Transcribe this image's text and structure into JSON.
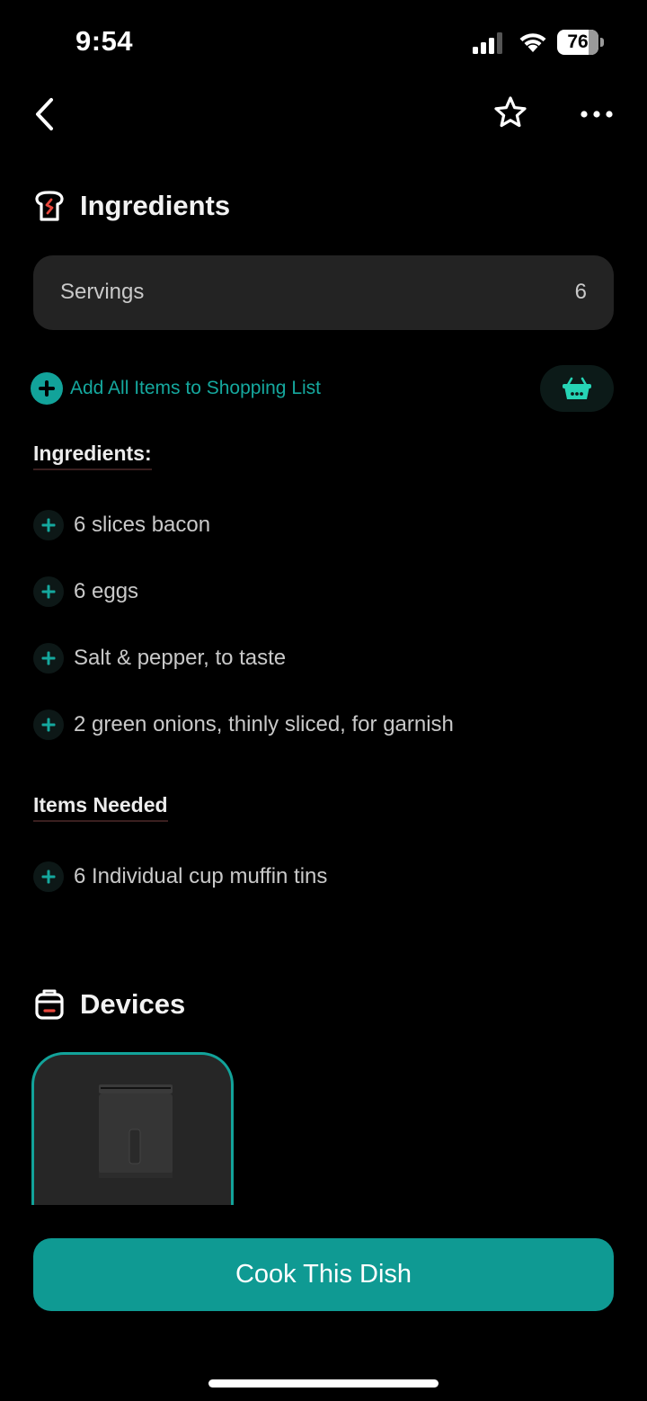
{
  "status_bar": {
    "time": "9:54",
    "battery": 76
  },
  "ingredients_section": {
    "title": "Ingredients",
    "servings": {
      "label": "Servings",
      "value": "6"
    },
    "add_all_label": "Add All Items to Shopping List",
    "subheading": "Ingredients:",
    "items": [
      "6 slices bacon",
      "6 eggs",
      "Salt & pepper, to taste",
      "2 green onions, thinly sliced, for garnish"
    ]
  },
  "items_needed": {
    "subheading": "Items Needed",
    "items": [
      "6 Individual cup muffin tins"
    ]
  },
  "devices_section": {
    "title": "Devices"
  },
  "cook_button_label": "Cook This Dish",
  "colors": {
    "accent": "#12a39a",
    "background": "#000000",
    "card": "#232323"
  }
}
